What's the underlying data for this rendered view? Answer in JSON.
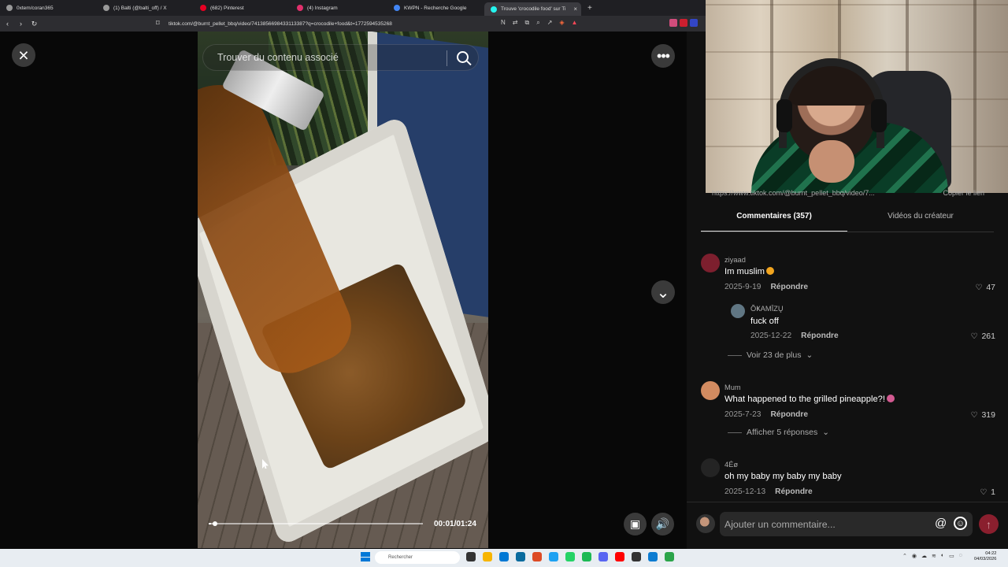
{
  "browser": {
    "tabs": [
      {
        "label": "0xtem/coran365",
        "icon_color": "#f0f0f0"
      },
      {
        "label": "(1) Balti (@balti_off) / X",
        "icon_color": "#ffffff"
      },
      {
        "label": "(682) Pinterest",
        "icon_color": "#e60023"
      },
      {
        "label": "(4) Instagram",
        "icon_color": "#e1306c"
      },
      {
        "label": "KWPN - Recherche Google",
        "icon_color": "#4285f4"
      },
      {
        "label": "Trouve 'crocodile food' sur Ti",
        "icon_color": "#25f4ee"
      }
    ],
    "new_tab": "+",
    "tab_close": "×",
    "url": "tiktok.com/@burnt_pellet_bbq/video/7413856698433113387?q=crocodile+food&t=1772594535268",
    "extension_colors": [
      "#d14d7c",
      "#cc1f2f",
      "#3346c6"
    ]
  },
  "video": {
    "search_placeholder": "Trouver du contenu associé",
    "time": "00:01/01:24",
    "progress": 0.012,
    "close_icon": "×",
    "more_icon": "•••",
    "chevron_icon": "⌄",
    "volume_icon": "🔊",
    "pip_icon": "▣"
  },
  "sidebar": {
    "link_text": "https://www.tiktok.com/@burnt_pellet_bbq/video/7...",
    "copy_link": "Copier le lien",
    "tabs": [
      "Commentaires (357)",
      "Vidéos du créateur"
    ],
    "comments": [
      {
        "user": "ziyaad",
        "text": "Im muslim",
        "date": "2025-9-19",
        "reply": "Répondre",
        "likes": "47",
        "avatar_color": "#7d1f2e",
        "emoji_color": "#f2a51f"
      },
      {
        "user": "ÕҜAMĪZŲ",
        "text": "fuck off",
        "date": "2025-12-22",
        "reply": "Répondre",
        "likes": "261",
        "avatar_color": "#607683"
      },
      {
        "user": "Mum",
        "text": "What happened to the grilled pineapple?!",
        "date": "2025-7-23",
        "reply": "Répondre",
        "likes": "319",
        "avatar_color": "#d28b60",
        "emoji_color": "#d35a91"
      },
      {
        "user": "4Éø",
        "text": "oh my baby my baby my baby",
        "date": "2025-12-13",
        "reply": "Répondre",
        "likes": "1",
        "avatar_color": "#242424"
      }
    ],
    "thread_1": "Voir 23 de plus",
    "thread_2": "Afficher 5 réponses",
    "input_placeholder": "Ajouter un commentaire...",
    "at_icon": "@",
    "emoji_icon": "☺",
    "send_icon": "↑"
  },
  "taskbar": {
    "search": "Rechercher",
    "time": "04:22",
    "date": "04/03/2026",
    "app_colors": [
      "#333333",
      "#f7b500",
      "#0078d4",
      "#0a6b9e",
      "#dd4b25",
      "#1da1f2",
      "#25d366",
      "#1db954",
      "#5865f2",
      "#ff0000",
      "#333333",
      "#0b7bd1",
      "#2ba44a"
    ]
  }
}
